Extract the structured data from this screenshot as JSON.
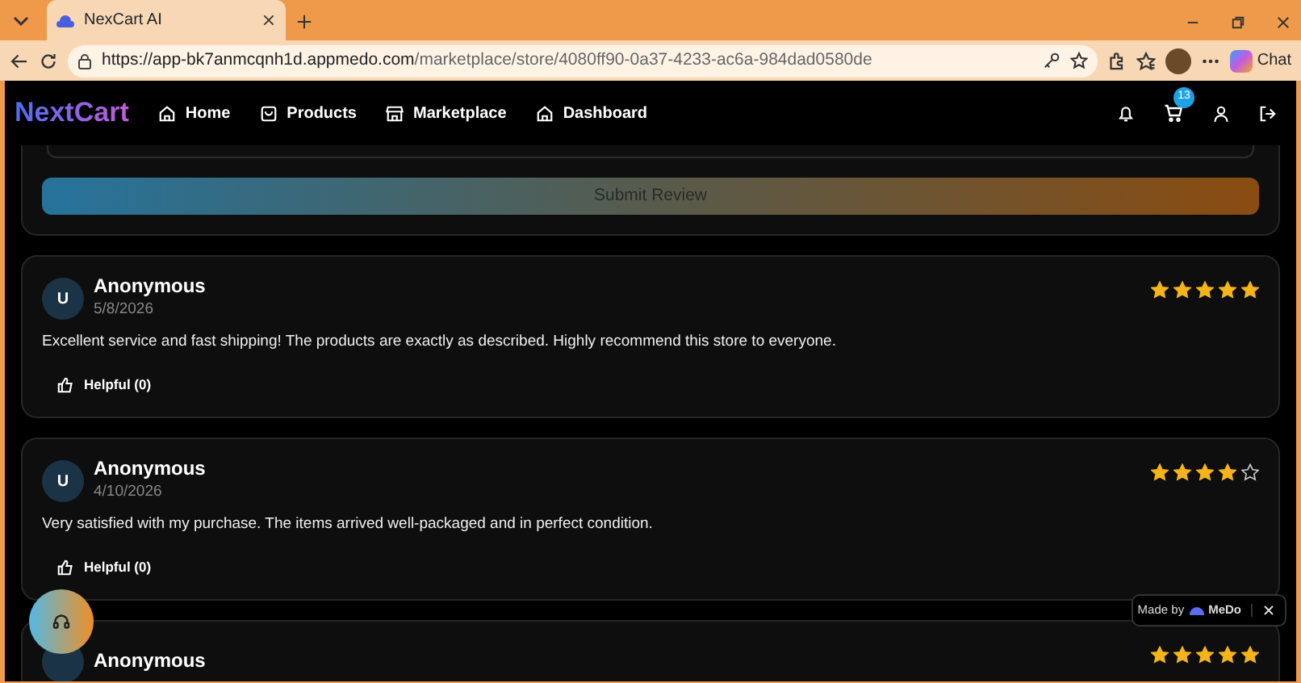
{
  "browser": {
    "tab_title": "NexCart AI",
    "url_host": "https://app-bk7anmcqnh1d.appmedo.com",
    "url_path": "/marketplace/store/4080ff90-0a37-4233-ac6a-984dad0580de",
    "chat_label": "Chat"
  },
  "navbar": {
    "brand": "NextCart",
    "links": [
      {
        "label": "Home"
      },
      {
        "label": "Products"
      },
      {
        "label": "Marketplace"
      },
      {
        "label": "Dashboard"
      }
    ],
    "cart_count": "13"
  },
  "review_form": {
    "submit_label": "Submit Review"
  },
  "reviews": [
    {
      "initial": "U",
      "name": "Anonymous",
      "date": "5/8/2026",
      "stars": 5,
      "text": "Excellent service and fast shipping! The products are exactly as described. Highly recommend this store to everyone.",
      "helpful": "Helpful (0)"
    },
    {
      "initial": "U",
      "name": "Anonymous",
      "date": "4/10/2026",
      "stars": 4,
      "text": "Very satisfied with my purchase. The items arrived well-packaged and in perfect condition.",
      "helpful": "Helpful (0)"
    },
    {
      "name": "Anonymous",
      "stars": 5
    }
  ],
  "made_by": {
    "label": "Made by",
    "brand": "MeDo"
  }
}
